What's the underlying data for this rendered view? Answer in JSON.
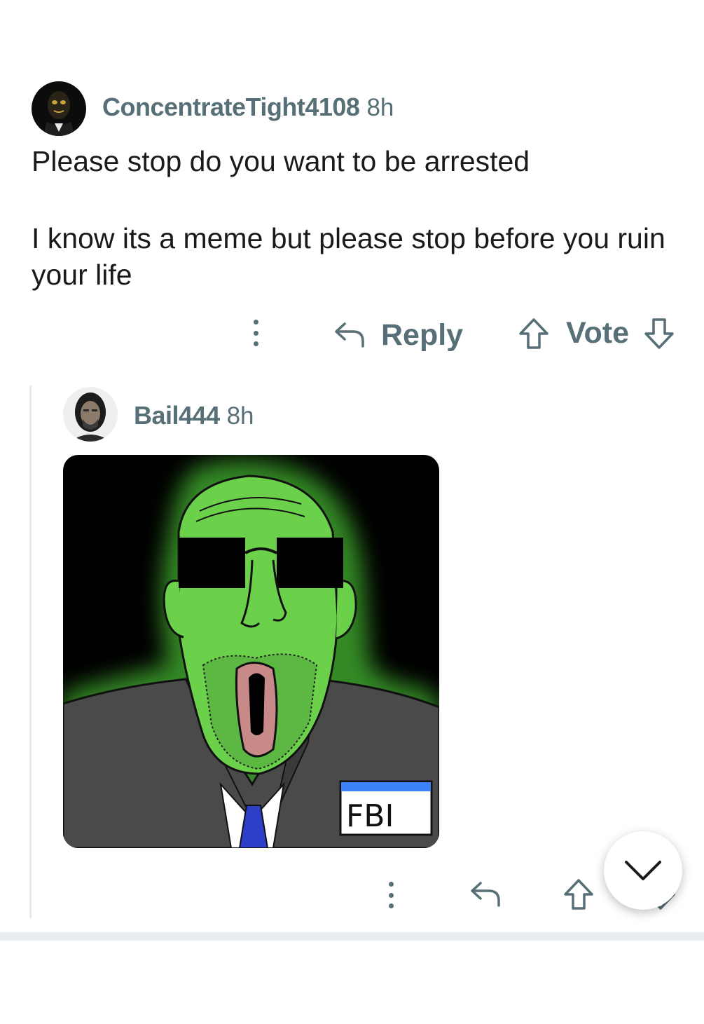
{
  "comment": {
    "username": "ConcentrateTight4108",
    "time": "8h",
    "paragraphs": [
      "Please stop do you want to be arrested",
      "I know its a meme but please stop before you ruin your life"
    ],
    "actions": {
      "reply_label": "Reply",
      "vote_label": "Vote"
    }
  },
  "reply": {
    "username": "Bail444",
    "time": "8h",
    "image": {
      "badge_text": "FBI"
    }
  },
  "icons": {
    "more": "kebab-icon",
    "reply": "reply-arrow-icon",
    "upvote": "upvote-arrow-icon",
    "downvote": "downvote-arrow-icon",
    "scroll": "chevron-down-icon"
  },
  "colors": {
    "meta_text": "#576f76",
    "body_text": "#1a1a1b",
    "meme_green": "#6bd14a",
    "meme_glow": "#3a9a2a",
    "suit": "#4a4a4a",
    "badge_stripe": "#3b82f6"
  }
}
